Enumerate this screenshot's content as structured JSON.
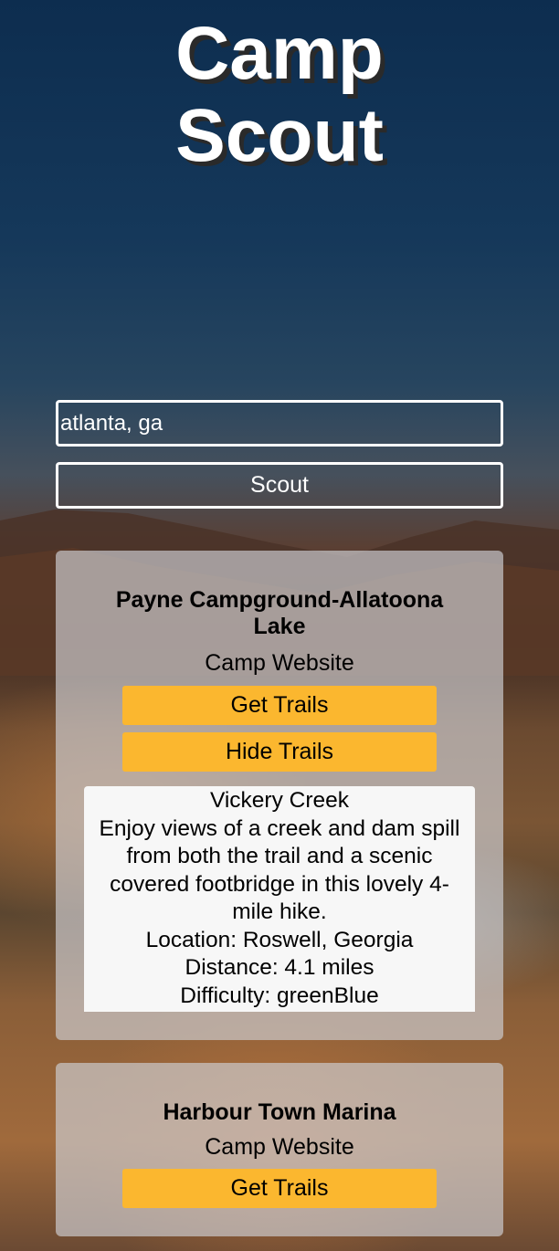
{
  "header": {
    "title_line1": "Camp",
    "title_line2": "Scout"
  },
  "search": {
    "value": "atlanta, ga",
    "button_label": "Scout"
  },
  "results": [
    {
      "name": "Payne Campground-Allatoona Lake",
      "website_label": "Camp Website",
      "get_trails_label": "Get Trails",
      "hide_trails_label": "Hide Trails",
      "trail": {
        "name": "Vickery Creek",
        "description": "Enjoy views of a creek and dam spill from both the trail and a scenic covered footbridge in this lovely 4-mile hike.",
        "location": "Location: Roswell, Georgia",
        "distance": "Distance: 4.1 miles",
        "difficulty": "Difficulty: greenBlue"
      }
    },
    {
      "name": "Harbour Town Marina",
      "website_label": "Camp Website",
      "get_trails_label": "Get Trails"
    }
  ],
  "colors": {
    "accent": "#fbb72f",
    "card_bg": "#cdcdd2",
    "text_light": "#ffffff"
  }
}
